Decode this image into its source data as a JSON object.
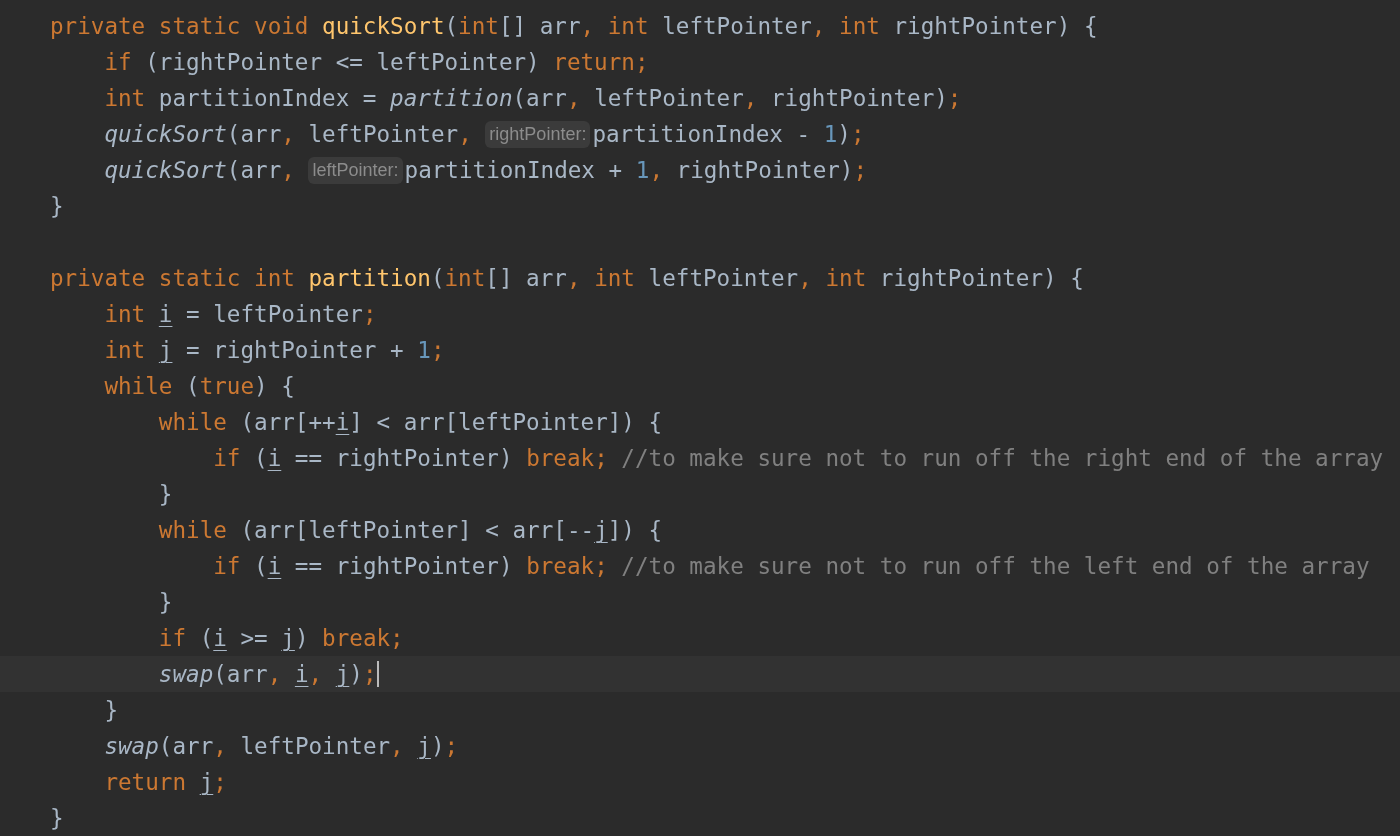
{
  "editor": {
    "lines": [
      {
        "kind": "code",
        "current": false,
        "tokens": [
          {
            "text": "private static void ",
            "kind": "keyword"
          },
          {
            "text": "quickSort",
            "kind": "declaration"
          },
          {
            "text": "(",
            "kind": "plain"
          },
          {
            "text": "int",
            "kind": "keyword"
          },
          {
            "text": "[] arr",
            "kind": "plain"
          },
          {
            "text": ", ",
            "kind": "keyword"
          },
          {
            "text": "int",
            "kind": "keyword"
          },
          {
            "text": " leftPointer",
            "kind": "plain"
          },
          {
            "text": ", ",
            "kind": "keyword"
          },
          {
            "text": "int",
            "kind": "keyword"
          },
          {
            "text": " rightPointer) {",
            "kind": "plain"
          }
        ]
      },
      {
        "kind": "code",
        "current": false,
        "tokens": [
          {
            "text": "    if",
            "kind": "keyword"
          },
          {
            "text": " (rightPointer <= leftPointer) ",
            "kind": "plain"
          },
          {
            "text": "return;",
            "kind": "keyword"
          }
        ]
      },
      {
        "kind": "code",
        "current": false,
        "tokens": [
          {
            "text": "    int",
            "kind": "keyword"
          },
          {
            "text": " partitionIndex = ",
            "kind": "plain"
          },
          {
            "text": "partition",
            "kind": "call"
          },
          {
            "text": "(arr",
            "kind": "plain"
          },
          {
            "text": ", ",
            "kind": "keyword"
          },
          {
            "text": "leftPointer",
            "kind": "plain"
          },
          {
            "text": ", ",
            "kind": "keyword"
          },
          {
            "text": "rightPointer)",
            "kind": "plain"
          },
          {
            "text": ";",
            "kind": "keyword"
          }
        ]
      },
      {
        "kind": "code",
        "current": false,
        "tokens": [
          {
            "text": "    quickSort",
            "kind": "call"
          },
          {
            "text": "(arr",
            "kind": "plain"
          },
          {
            "text": ", ",
            "kind": "keyword"
          },
          {
            "text": "leftPointer",
            "kind": "plain"
          },
          {
            "text": ", ",
            "kind": "keyword"
          },
          {
            "text": "rightPointer:",
            "kind": "hint"
          },
          {
            "text": "partitionIndex - ",
            "kind": "plain"
          },
          {
            "text": "1",
            "kind": "number"
          },
          {
            "text": ")",
            "kind": "plain"
          },
          {
            "text": ";",
            "kind": "keyword"
          }
        ]
      },
      {
        "kind": "code",
        "current": false,
        "tokens": [
          {
            "text": "    quickSort",
            "kind": "call"
          },
          {
            "text": "(arr",
            "kind": "plain"
          },
          {
            "text": ", ",
            "kind": "keyword"
          },
          {
            "text": "leftPointer:",
            "kind": "hint"
          },
          {
            "text": "partitionIndex + ",
            "kind": "plain"
          },
          {
            "text": "1",
            "kind": "number"
          },
          {
            "text": ", ",
            "kind": "keyword"
          },
          {
            "text": "rightPointer)",
            "kind": "plain"
          },
          {
            "text": ";",
            "kind": "keyword"
          }
        ]
      },
      {
        "kind": "code",
        "current": false,
        "tokens": [
          {
            "text": "}",
            "kind": "plain"
          }
        ]
      },
      {
        "kind": "code",
        "current": false
      },
      {
        "kind": "code",
        "current": false,
        "tokens": [
          {
            "text": "private static int ",
            "kind": "keyword"
          },
          {
            "text": "partition",
            "kind": "declaration"
          },
          {
            "text": "(",
            "kind": "plain"
          },
          {
            "text": "int",
            "kind": "keyword"
          },
          {
            "text": "[] arr",
            "kind": "plain"
          },
          {
            "text": ", ",
            "kind": "keyword"
          },
          {
            "text": "int",
            "kind": "keyword"
          },
          {
            "text": " leftPointer",
            "kind": "plain"
          },
          {
            "text": ", ",
            "kind": "keyword"
          },
          {
            "text": "int",
            "kind": "keyword"
          },
          {
            "text": " rightPointer) {",
            "kind": "plain"
          }
        ]
      },
      {
        "kind": "code",
        "current": false,
        "tokens": [
          {
            "text": "    int ",
            "kind": "keyword"
          },
          {
            "text": "i",
            "kind": "local"
          },
          {
            "text": " = leftPointer",
            "kind": "plain"
          },
          {
            "text": ";",
            "kind": "keyword"
          }
        ]
      },
      {
        "kind": "code",
        "current": false,
        "tokens": [
          {
            "text": "    int ",
            "kind": "keyword"
          },
          {
            "text": "j",
            "kind": "local"
          },
          {
            "text": " = rightPointer + ",
            "kind": "plain"
          },
          {
            "text": "1",
            "kind": "number"
          },
          {
            "text": ";",
            "kind": "keyword"
          }
        ]
      },
      {
        "kind": "code",
        "current": false,
        "tokens": [
          {
            "text": "    while",
            "kind": "keyword"
          },
          {
            "text": " (",
            "kind": "plain"
          },
          {
            "text": "true",
            "kind": "keyword"
          },
          {
            "text": ") {",
            "kind": "plain"
          }
        ]
      },
      {
        "kind": "code",
        "current": false,
        "tokens": [
          {
            "text": "        while",
            "kind": "keyword"
          },
          {
            "text": " (arr[++",
            "kind": "plain"
          },
          {
            "text": "i",
            "kind": "local"
          },
          {
            "text": "] < arr[leftPointer]) {",
            "kind": "plain"
          }
        ]
      },
      {
        "kind": "code",
        "current": false,
        "tokens": [
          {
            "text": "            if",
            "kind": "keyword"
          },
          {
            "text": " (",
            "kind": "plain"
          },
          {
            "text": "i",
            "kind": "local"
          },
          {
            "text": " == rightPointer) ",
            "kind": "plain"
          },
          {
            "text": "break;",
            "kind": "keyword"
          },
          {
            "text": " //to make sure not to run off the right end of the array",
            "kind": "comment"
          }
        ]
      },
      {
        "kind": "code",
        "current": false,
        "tokens": [
          {
            "text": "        }",
            "kind": "plain"
          }
        ]
      },
      {
        "kind": "code",
        "current": false,
        "tokens": [
          {
            "text": "        while",
            "kind": "keyword"
          },
          {
            "text": " (arr[leftPointer] < arr[--",
            "kind": "plain"
          },
          {
            "text": "j",
            "kind": "local"
          },
          {
            "text": "]) {",
            "kind": "plain"
          }
        ]
      },
      {
        "kind": "code",
        "current": false,
        "tokens": [
          {
            "text": "            if",
            "kind": "keyword"
          },
          {
            "text": " (",
            "kind": "plain"
          },
          {
            "text": "i",
            "kind": "local"
          },
          {
            "text": " == rightPointer) ",
            "kind": "plain"
          },
          {
            "text": "break;",
            "kind": "keyword"
          },
          {
            "text": " //to make sure not to run off the left end of the array",
            "kind": "comment"
          }
        ]
      },
      {
        "kind": "code",
        "current": false,
        "tokens": [
          {
            "text": "        }",
            "kind": "plain"
          }
        ]
      },
      {
        "kind": "code",
        "current": false,
        "tokens": [
          {
            "text": "        if",
            "kind": "keyword"
          },
          {
            "text": " (",
            "kind": "plain"
          },
          {
            "text": "i",
            "kind": "local"
          },
          {
            "text": " >= ",
            "kind": "plain"
          },
          {
            "text": "j",
            "kind": "local"
          },
          {
            "text": ") ",
            "kind": "plain"
          },
          {
            "text": "break;",
            "kind": "keyword"
          }
        ]
      },
      {
        "kind": "code",
        "current": true,
        "tokens": [
          {
            "text": "        swap",
            "kind": "call"
          },
          {
            "text": "(arr",
            "kind": "plain"
          },
          {
            "text": ", ",
            "kind": "keyword"
          },
          {
            "text": "i",
            "kind": "local"
          },
          {
            "text": ", ",
            "kind": "keyword"
          },
          {
            "text": "j",
            "kind": "local"
          },
          {
            "text": ")",
            "kind": "plain"
          },
          {
            "text": ";",
            "kind": "keyword"
          }
        ]
      },
      {
        "kind": "code",
        "current": false,
        "tokens": [
          {
            "text": "    }",
            "kind": "plain"
          }
        ]
      },
      {
        "kind": "code",
        "current": false,
        "tokens": [
          {
            "text": "    swap",
            "kind": "call"
          },
          {
            "text": "(arr",
            "kind": "plain"
          },
          {
            "text": ", ",
            "kind": "keyword"
          },
          {
            "text": "leftPointer",
            "kind": "plain"
          },
          {
            "text": ", ",
            "kind": "keyword"
          },
          {
            "text": "j",
            "kind": "local"
          },
          {
            "text": ")",
            "kind": "plain"
          },
          {
            "text": ";",
            "kind": "keyword"
          }
        ]
      },
      {
        "kind": "code",
        "current": false,
        "tokens": [
          {
            "text": "    return ",
            "kind": "keyword"
          },
          {
            "text": "j",
            "kind": "local"
          },
          {
            "text": ";",
            "kind": "keyword"
          }
        ]
      },
      {
        "kind": "code",
        "current": false,
        "tokens": [
          {
            "text": "}",
            "kind": "plain"
          }
        ]
      }
    ]
  }
}
